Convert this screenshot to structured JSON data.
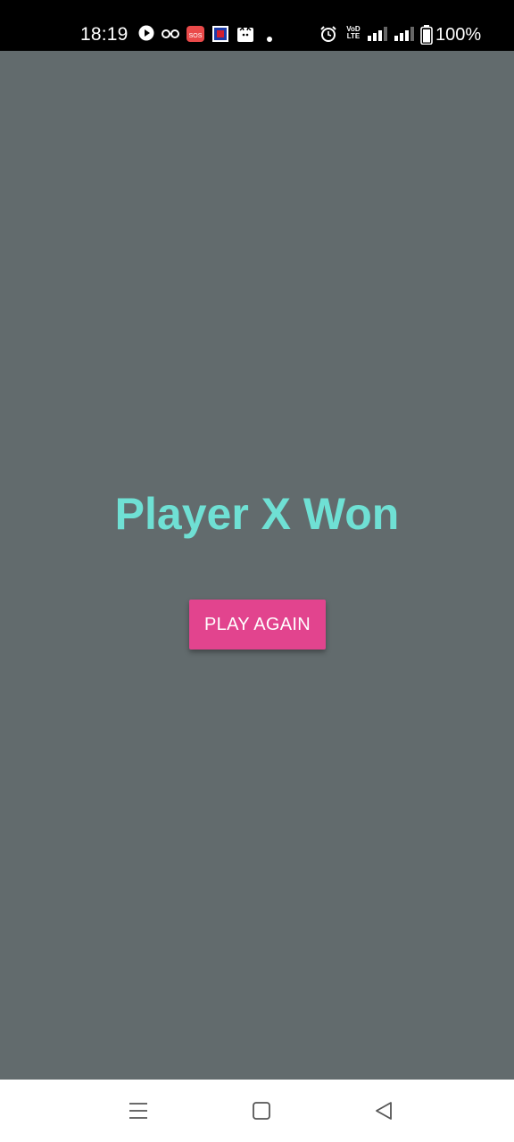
{
  "status_bar": {
    "time": "18:19",
    "battery": "100%",
    "network_label": "VoD LTE",
    "icons": [
      "play-icon",
      "glasses-icon",
      "sos-icon",
      "app-icon",
      "cat-icon",
      "dot-icon",
      "alarm-icon",
      "signal-icon",
      "signal-icon",
      "battery-icon"
    ]
  },
  "game": {
    "result_text": "Player X Won",
    "play_again_label": "PLAY AGAIN"
  },
  "nav_bar": {
    "buttons": [
      "menu-icon",
      "home-icon",
      "back-icon"
    ]
  },
  "colors": {
    "background": "#626b6d",
    "title": "#6fe0d4",
    "button": "#e2448e",
    "status_bar": "#000000",
    "nav_bar": "#ffffff"
  }
}
